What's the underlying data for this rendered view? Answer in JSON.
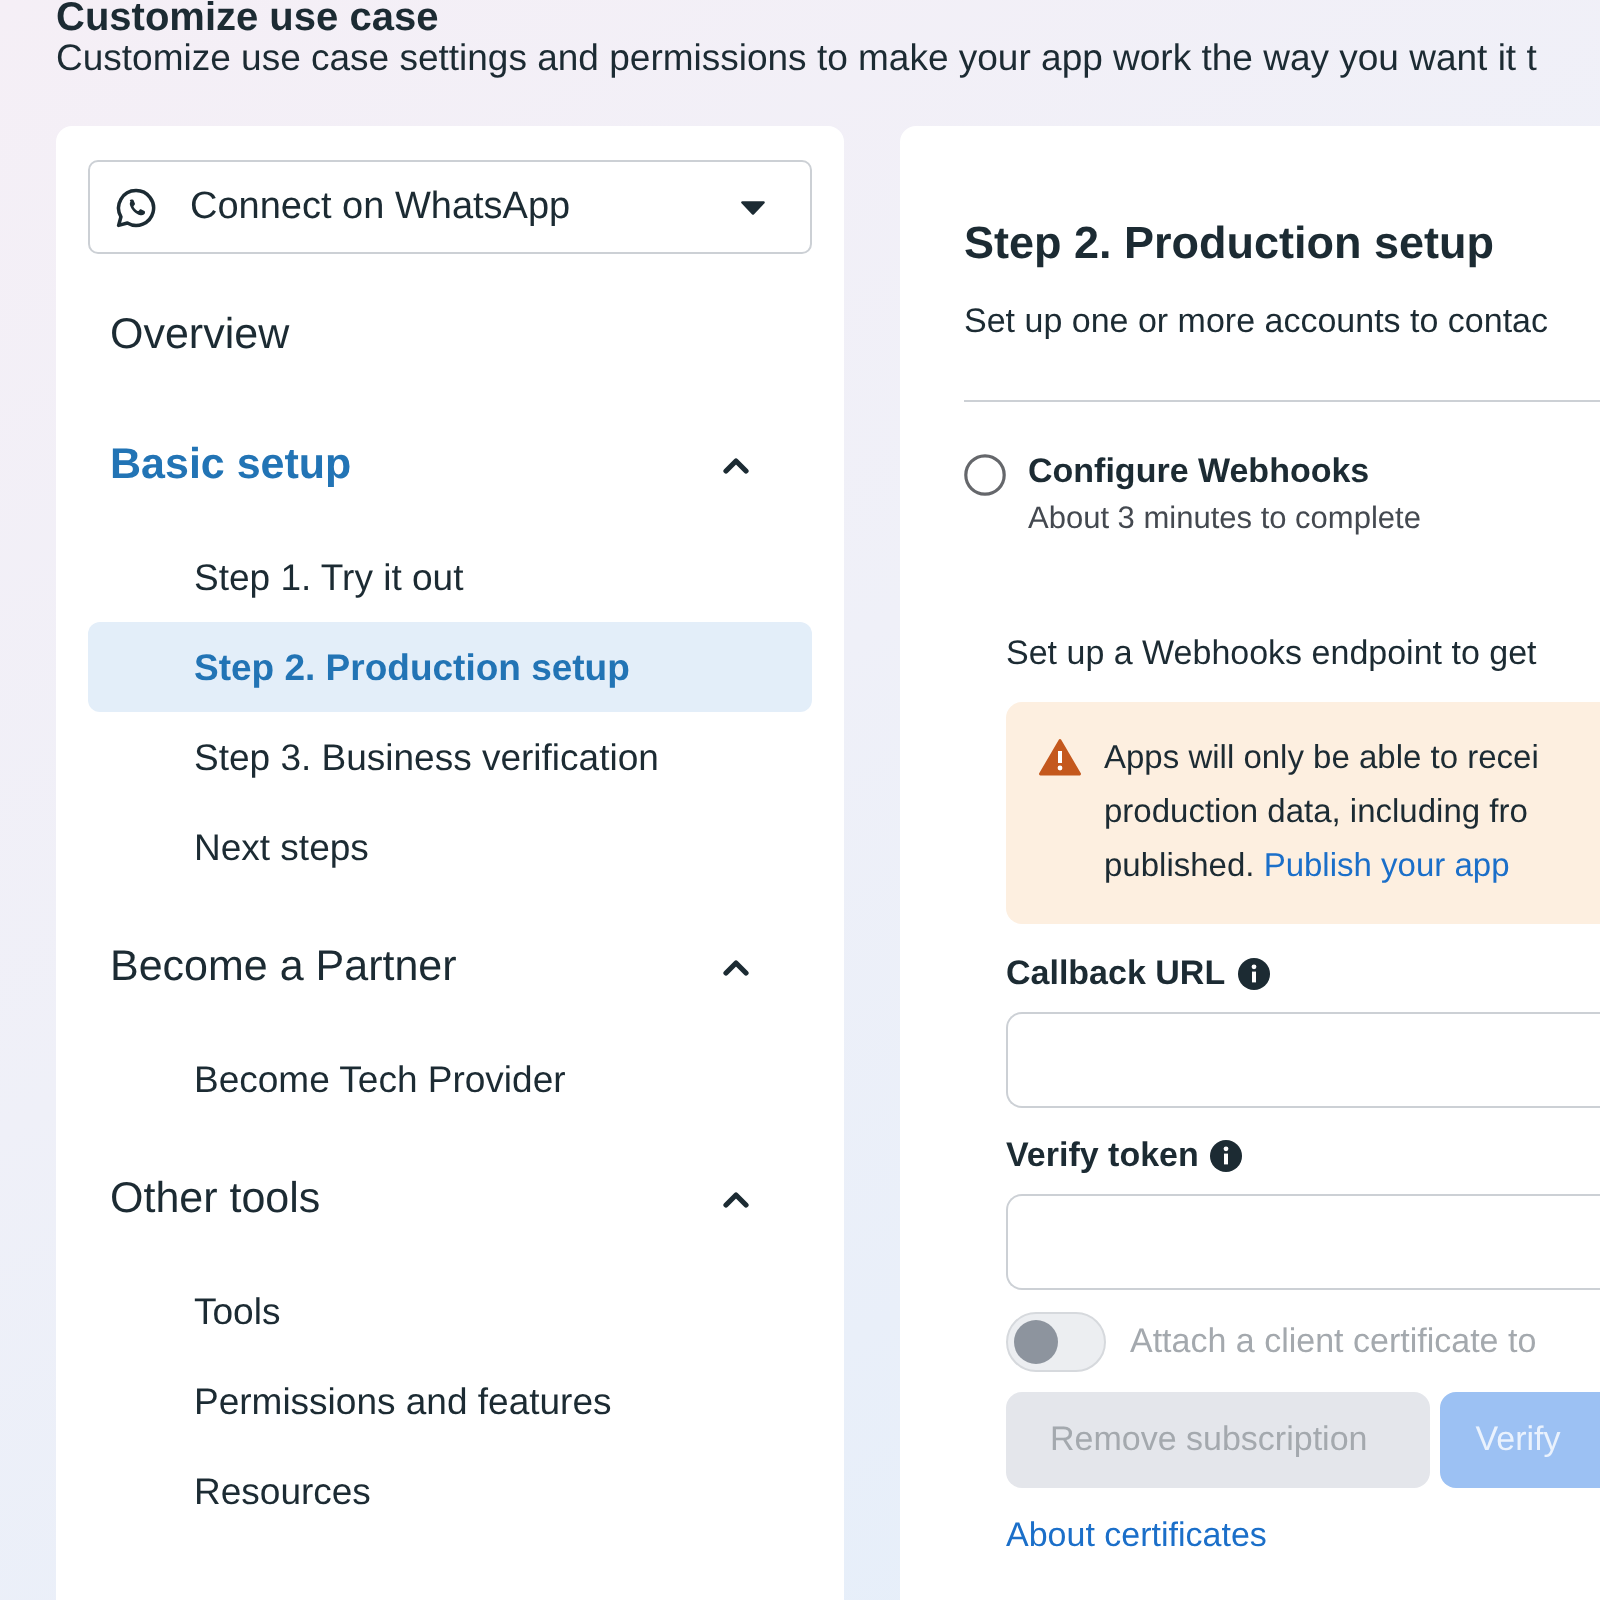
{
  "header": {
    "title": "Customize use case",
    "subtitle": "Customize use case settings and permissions to make your app work the way you want it t"
  },
  "sidebar": {
    "use_case_dropdown": {
      "value": "Connect on WhatsApp"
    },
    "items": [
      {
        "kind": "link",
        "label": "Overview",
        "selected": false
      },
      {
        "kind": "section",
        "label": "Basic setup",
        "expanded": true,
        "children": [
          {
            "label": "Step 1. Try it out",
            "selected": false
          },
          {
            "label": "Step 2. Production setup",
            "selected": true
          },
          {
            "label": "Step 3. Business verification",
            "selected": false
          },
          {
            "label": "Next steps",
            "selected": false
          }
        ]
      },
      {
        "kind": "section",
        "label": "Become a Partner",
        "expanded": true,
        "children": [
          {
            "label": "Become Tech Provider",
            "selected": false
          }
        ]
      },
      {
        "kind": "section",
        "label": "Other tools",
        "expanded": true,
        "children": [
          {
            "label": "Tools",
            "selected": false
          },
          {
            "label": "Permissions and features",
            "selected": false
          },
          {
            "label": "Resources",
            "selected": false
          }
        ]
      }
    ]
  },
  "main": {
    "title": "Step 2. Production setup",
    "description": "Set up one or more accounts to contac",
    "task": {
      "title": "Configure Webhooks",
      "duration": "About 3 minutes to complete",
      "completed": false
    },
    "intro": "Set up a Webhooks endpoint to get",
    "warning": {
      "lines": [
        "Apps will only be able to recei",
        "production data, including fro",
        "published."
      ],
      "link": "Publish your app"
    },
    "fields": [
      {
        "label": "Callback URL"
      },
      {
        "label": "Verify token"
      }
    ],
    "toggle": {
      "label": "Attach a client certificate to",
      "on": false,
      "disabled": true
    },
    "buttons": [
      {
        "label": "Remove subscription",
        "kind": "secondary",
        "disabled": true
      },
      {
        "label": "Verify",
        "kind": "primary",
        "disabled": true
      }
    ],
    "link": "About certificates"
  }
}
